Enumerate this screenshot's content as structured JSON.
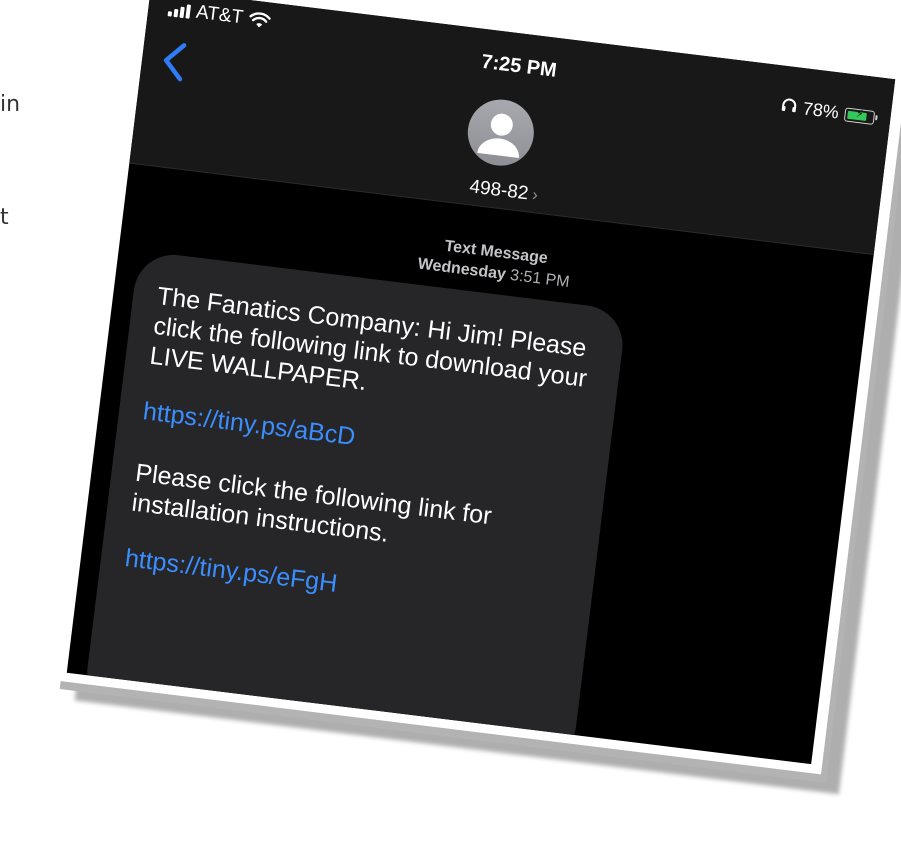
{
  "background": {
    "text_1": "in",
    "text_2": "t"
  },
  "status_bar": {
    "carrier": "AT&T",
    "time": "7:25 PM",
    "battery_percent": "78%",
    "battery_level": 0.78,
    "battery_color": "#34c759"
  },
  "nav": {
    "back_icon": "chevron-left-icon",
    "contact_label": "498-82",
    "contact_chevron": "›",
    "avatar_icon": "person-icon"
  },
  "conversation": {
    "meta_label": "Text Message",
    "meta_day": "Wednesday",
    "meta_time": "3:51 PM",
    "message": {
      "paragraph_1": "The Fanatics Company: Hi Jim! Please click the following link to download your LIVE WALLPAPER.",
      "link_1": "https://tiny.ps/aBcD",
      "paragraph_2": "Please click the following link for installation instructions.",
      "link_2": "https://tiny.ps/eFgH"
    }
  },
  "colors": {
    "link": "#3a8eff",
    "back_chevron": "#2f7cf6",
    "bubble": "#262628",
    "screen_bg": "#000000"
  }
}
